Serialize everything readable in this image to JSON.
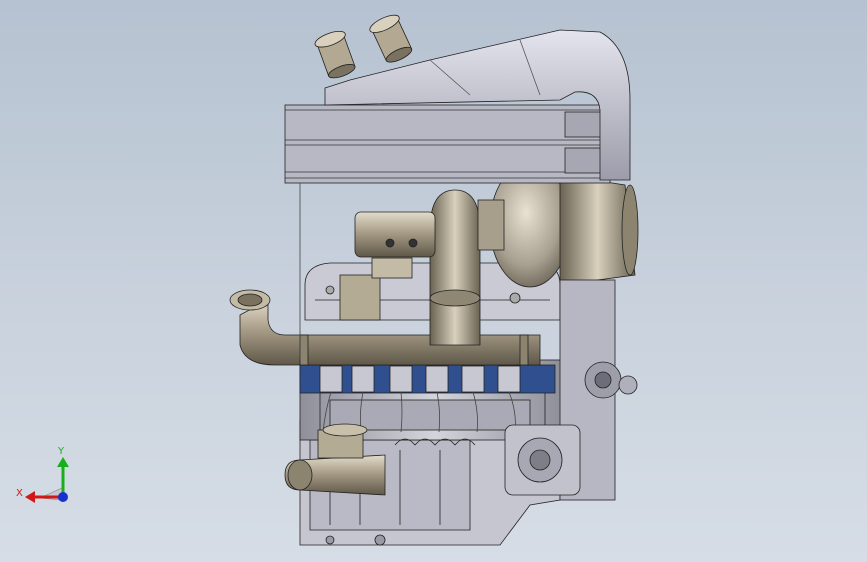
{
  "viewport": {
    "background_top": "#b6c2d1",
    "background_bottom": "#d6dde6",
    "model_colors": {
      "body": "#c2c2cc",
      "body_dark": "#8e8e98",
      "pipe": "#a89d88",
      "pipe_dark": "#6f6656",
      "manifold_blue": "#2f4f8e",
      "edge": "#222222"
    }
  },
  "triad": {
    "x_label": "X",
    "y_label": "Y",
    "x_color": "#d01818",
    "y_color": "#18b018",
    "z_color": "#1830d0"
  }
}
